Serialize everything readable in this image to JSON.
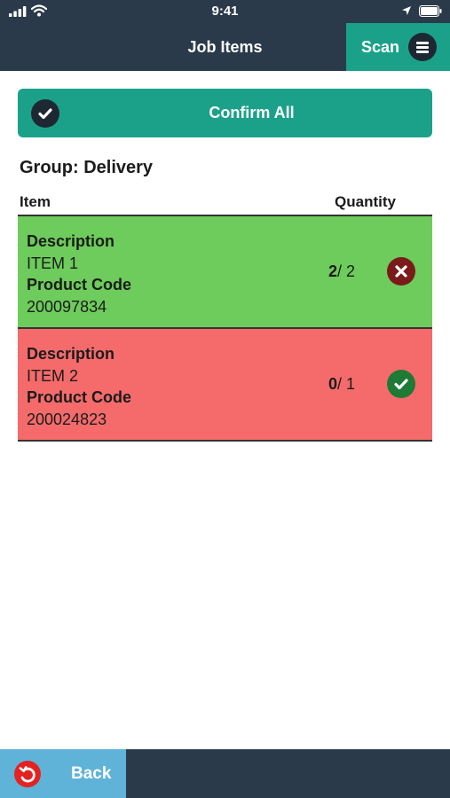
{
  "status_bar": {
    "time": "9:41"
  },
  "header": {
    "title": "Job Items",
    "scan_label": "Scan"
  },
  "confirm_all": {
    "label": "Confirm All"
  },
  "group": {
    "title": "Group: Delivery"
  },
  "columns": {
    "item": "Item",
    "quantity": "Quantity"
  },
  "items": [
    {
      "description_label": "Description",
      "description": "ITEM 1",
      "product_code_label": "Product Code",
      "product_code": "200097834",
      "qty_done": "2",
      "qty_total": "/ 2",
      "row_color": "#6dcc5b",
      "action_icon": "close-icon"
    },
    {
      "description_label": "Description",
      "description": "ITEM 2",
      "product_code_label": "Product Code",
      "product_code": "200024823",
      "qty_done": "0",
      "qty_total": "/ 1",
      "row_color": "#f56b6b",
      "action_icon": "check-icon"
    }
  ],
  "footer": {
    "back_label": "Back"
  },
  "colors": {
    "header": "#2b3a4a",
    "accent": "#1ba189",
    "back": "#5fb3d8"
  }
}
